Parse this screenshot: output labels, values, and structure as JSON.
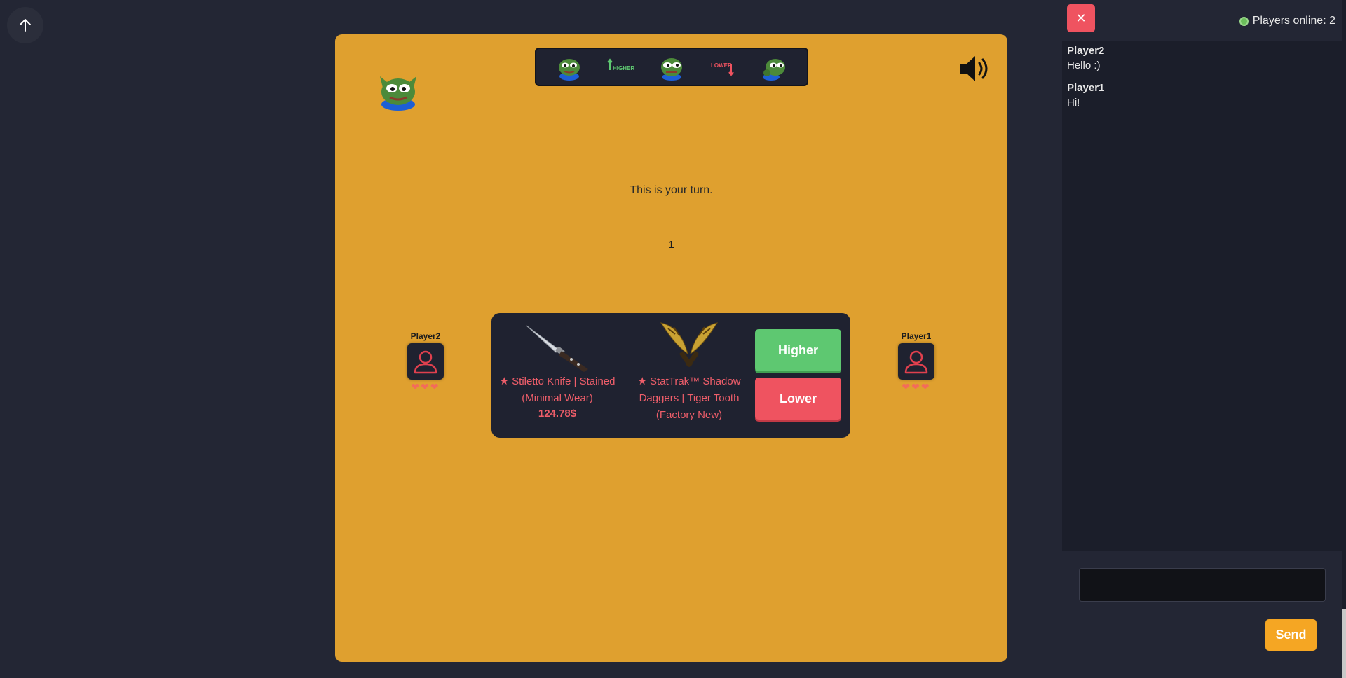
{
  "nav": {
    "scroll_top_icon": "arrow-up-icon"
  },
  "game": {
    "background": "#dfa02f",
    "emotes": [
      {
        "name": "pepe-hands-icon"
      },
      {
        "name": "higher-emote-icon",
        "text": "HIGHER"
      },
      {
        "name": "pepe-stare-icon"
      },
      {
        "name": "lower-emote-icon",
        "text": "LOWER"
      },
      {
        "name": "pepe-think-icon"
      }
    ],
    "sound_icon": "speaker-icon",
    "turn_text": "This is your turn.",
    "counter": "1",
    "players": {
      "left": {
        "name": "Player2",
        "hearts": "❤❤❤"
      },
      "right": {
        "name": "Player1",
        "hearts": "❤❤❤"
      }
    },
    "items": [
      {
        "name": "★ Stiletto Knife | Stained (Minimal Wear)",
        "price": "124.78$"
      },
      {
        "name": "★ StatTrak™ Shadow Daggers | Tiger Tooth (Factory New)"
      }
    ],
    "buttons": {
      "higher": "Higher",
      "lower": "Lower"
    }
  },
  "chat": {
    "close_label": "✕",
    "online_text": "Players online: 2",
    "messages": [
      {
        "author": "Player2",
        "text": "Hello :)"
      },
      {
        "author": "Player1",
        "text": "Hi!"
      }
    ],
    "input_value": "",
    "send_label": "Send"
  },
  "colors": {
    "accent_green": "#5ec871",
    "accent_red": "#ef5360",
    "send_orange": "#f5a623",
    "item_text": "#ef5e6a"
  }
}
